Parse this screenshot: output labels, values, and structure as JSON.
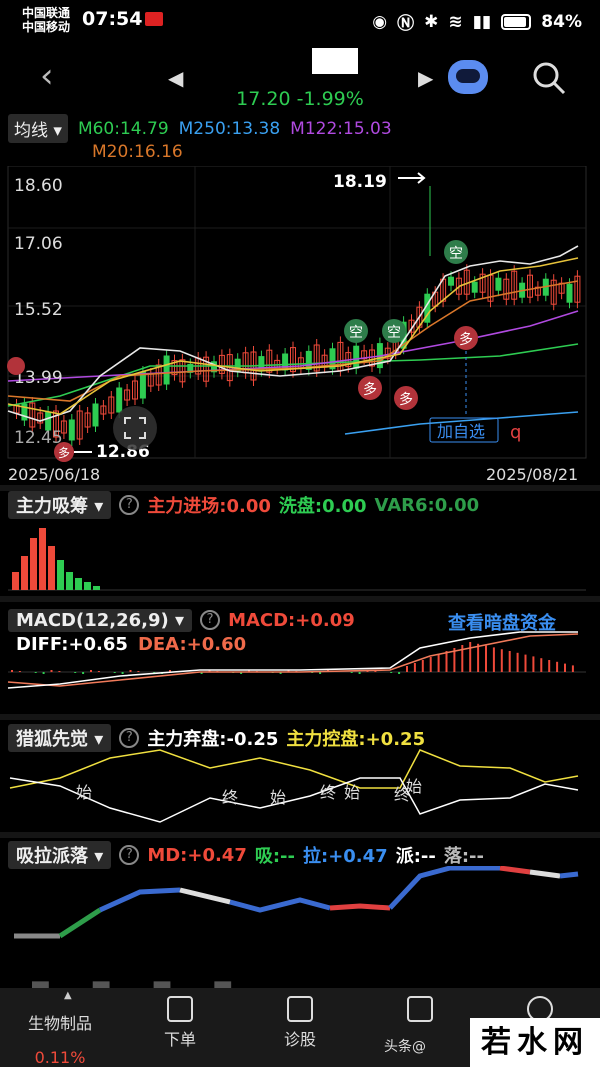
{
  "status": {
    "carrier1": "中国联通",
    "carrier2": "中国移动",
    "time": "07:54",
    "battery": "84%"
  },
  "nav": {
    "price_change": "17.20 -1.99%"
  },
  "ma": {
    "selector": "均线",
    "m60": "M60:14.79",
    "m250": "M250:13.38",
    "m122": "M122:15.03",
    "m20": "M20:16.16",
    "colors": {
      "m60": "#2ecc52",
      "m250": "#3aa0f0",
      "m122": "#b04ae0",
      "m20": "#d9772a"
    }
  },
  "price_chart": {
    "axis_labels": [
      "18.60",
      "17.06",
      "15.52",
      "13.99",
      "12.45"
    ],
    "date_start": "2025/06/18",
    "date_end": "2025/08/21",
    "high_label": "18.19",
    "low_label": "12.86",
    "add_watch": "加自选",
    "kong": "空",
    "duo": "多",
    "q_mark": "q"
  },
  "panel1": {
    "name": "主力吸筹",
    "v1": "主力进场:0.00",
    "v2": "洗盘:0.00",
    "v3": "VAR6:0.00"
  },
  "panel2": {
    "name": "MACD(12,26,9)",
    "macd": "MACD:+0.09",
    "link": "查看暗盘资金",
    "diff": "DIFF:+0.65",
    "dea": "DEA:+0.60"
  },
  "panel3": {
    "name": "猎狐先觉",
    "v1": "主力弃盘:-0.25",
    "v2": "主力控盘:+0.25",
    "marks": [
      "始",
      "终",
      "始",
      "终",
      "始",
      "终",
      "始"
    ]
  },
  "panel4": {
    "name": "吸拉派落",
    "md": "MD:+0.47",
    "xi": "吸:--",
    "la": "拉:+0.47",
    "pai": "派:--",
    "luo": "落:--"
  },
  "dock": {
    "sector": "生物制品",
    "sector_change": "0.11%",
    "order": "下单",
    "diagnose": "诊股",
    "watermark_src": "头条@",
    "watermark": "若水网"
  }
}
